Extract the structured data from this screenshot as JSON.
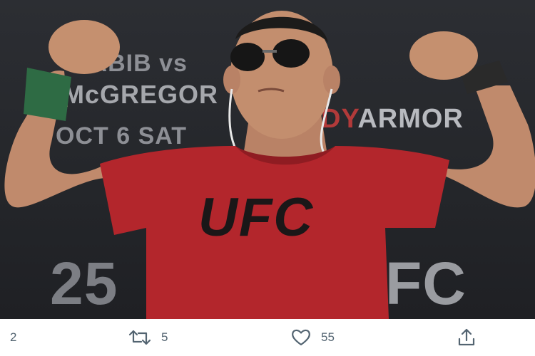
{
  "photo": {
    "backdrop": {
      "line1": "HABIB vs",
      "line2": "McGREGOR",
      "line3": "OCT 6 SAT",
      "sponsor_prefix": "DY",
      "sponsor": "ARMOR",
      "event_number": "25",
      "brand_partial": "FC"
    },
    "shirt_logo": "UFC"
  },
  "actions": {
    "reply_count": "2",
    "retweet_count": "5",
    "like_count": "55"
  },
  "colors": {
    "shirt": "#b3262c",
    "icon_gray": "#536471",
    "background": "#ffffff"
  }
}
